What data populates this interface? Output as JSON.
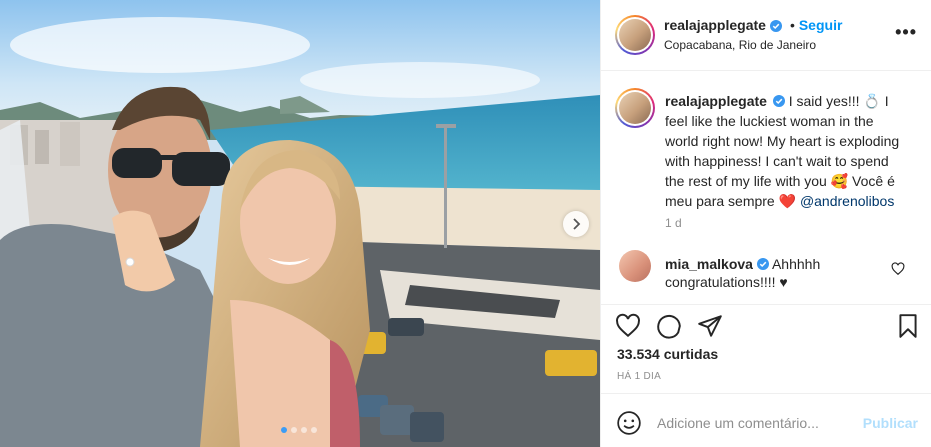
{
  "post": {
    "username": "realajapplegate",
    "follow_label": "Seguir",
    "separator": "•",
    "location": "Copacabana, Rio de Janeiro",
    "more_icon": "more-options-icon"
  },
  "caption": {
    "username": "realajapplegate",
    "text": "I said yes!!! 💍 I feel like the luckiest woman in the world right now! My heart is exploding with happiness! I can't wait to spend the rest of my life with you 🥰 Você é meu para sempre ❤️ ",
    "mention": "@andrenolibos",
    "time": "1 d"
  },
  "comment": {
    "username": "mia_malkova",
    "text": " Ahhhhh congratulations!!!! ♥"
  },
  "actions": {
    "likes": "33.534 curtidas",
    "posted_ago": "HÁ 1 DIA"
  },
  "add_comment": {
    "placeholder": "Adicione um comentário...",
    "publish_label": "Publicar"
  },
  "carousel": {
    "total": 4,
    "active_index": 0
  },
  "colors": {
    "accent": "#0095f6",
    "publish_disabled": "#b2dffc",
    "mention": "#00376b",
    "heart": "#ed4956"
  }
}
